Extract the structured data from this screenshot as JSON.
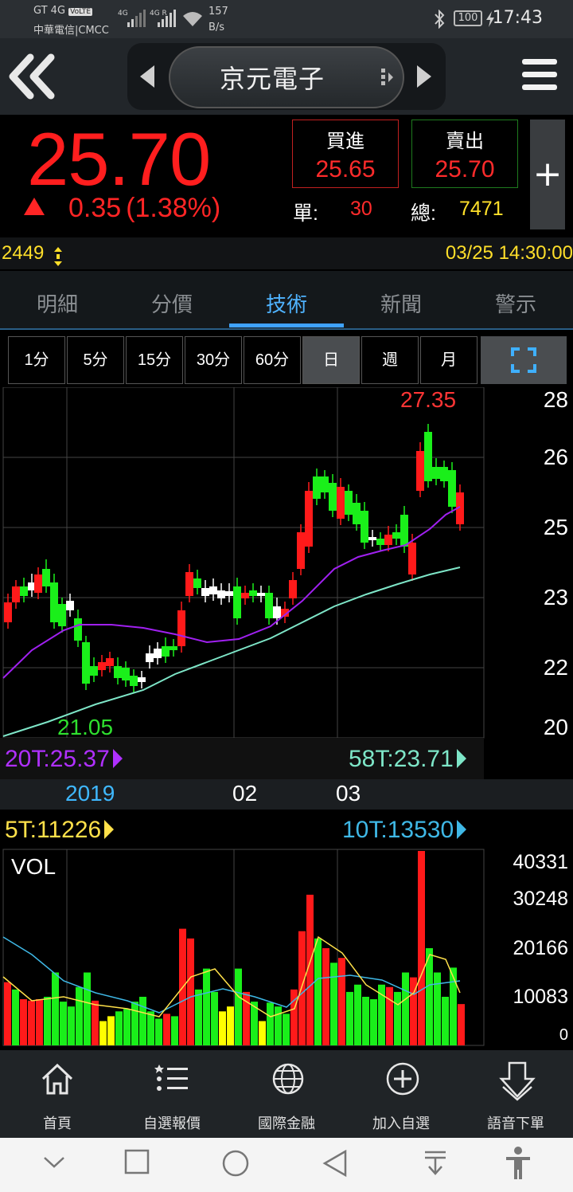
{
  "status_bar": {
    "network": "GT 4G",
    "volte": "VoLTE",
    "carrier": "中華電信|CMCC",
    "sig1": "4G",
    "sig2": "4G R",
    "speed_value": "157",
    "speed_unit": "B/s",
    "battery": "100",
    "time": "17:43"
  },
  "header": {
    "stock_name": "京元電子"
  },
  "quote": {
    "price": "25.70",
    "change": "0.35",
    "change_pct": "(1.38%)",
    "buy_label": "買進",
    "buy_price": "25.65",
    "sell_label": "賣出",
    "sell_price": "25.70",
    "single_label": "單:",
    "single_value": "30",
    "total_label": "總:",
    "total_value": "7471",
    "plus": "+"
  },
  "info": {
    "code": "2449",
    "datetime": "03/25 14:30:00"
  },
  "tabs": [
    {
      "label": "明細"
    },
    {
      "label": "分價"
    },
    {
      "label": "技術"
    },
    {
      "label": "新聞"
    },
    {
      "label": "警示"
    }
  ],
  "active_tab": "技術",
  "periods": [
    {
      "label": "1分"
    },
    {
      "label": "5分"
    },
    {
      "label": "15分"
    },
    {
      "label": "30分"
    },
    {
      "label": "60分"
    },
    {
      "label": "日"
    },
    {
      "label": "週"
    },
    {
      "label": "月"
    }
  ],
  "selected_period": "日",
  "chart": {
    "high_label": "27.35",
    "low_label": "21.05",
    "y_ticks": [
      "28",
      "26",
      "25",
      "23",
      "22",
      "20"
    ],
    "ma20_label": "20T:25.37",
    "ma58_label": "58T:23.71",
    "x_labels": [
      "2019",
      "02",
      "03"
    ],
    "vol_ma5_label": "5T:11226",
    "vol_ma10_label": "10T:13530",
    "vol_title": "VOL",
    "vol_ticks": [
      "40331",
      "30248",
      "20166",
      "10083",
      "0"
    ],
    "colors": {
      "up": "#ff1a1a",
      "down": "#1aef1a",
      "flat": "#ffff00",
      "ma20": "#a020f0",
      "ma58": "#7ee6c8",
      "ma5_vol": "#ffe14a",
      "ma10_vol": "#3fb8e6"
    }
  },
  "bottom_nav": [
    {
      "label": "首頁",
      "icon": "home-icon"
    },
    {
      "label": "自選報價",
      "icon": "list-icon"
    },
    {
      "label": "國際金融",
      "icon": "globe-icon"
    },
    {
      "label": "加入自選",
      "icon": "add-circle-icon"
    },
    {
      "label": "語音下單",
      "icon": "voice-order-icon"
    }
  ]
}
